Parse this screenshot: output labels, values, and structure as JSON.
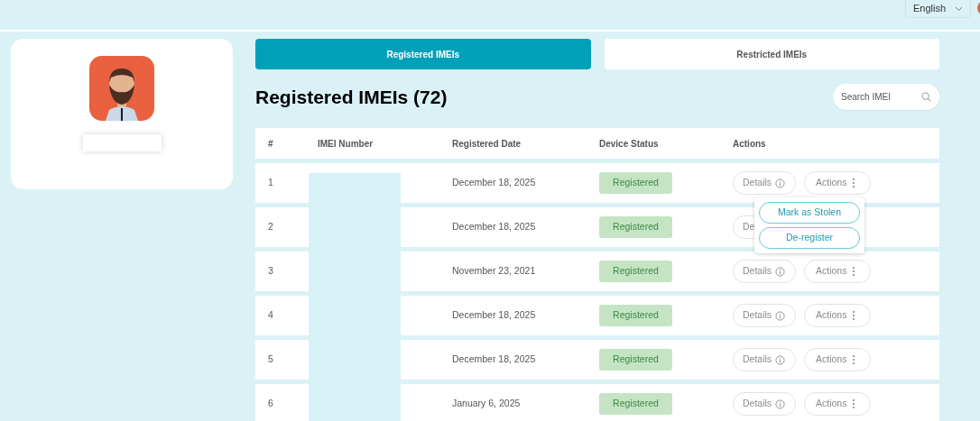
{
  "language_select": {
    "value": "English"
  },
  "tabs": [
    {
      "label": "Registered IMEIs",
      "selected": true
    },
    {
      "label": "Restricted IMEIs",
      "selected": false
    }
  ],
  "title": "Registered IMEIs (72)",
  "search": {
    "placeholder": "Search IMEI"
  },
  "table": {
    "columns": [
      "#",
      "IMEI Number",
      "Registered Date",
      "Device Status",
      "Actions"
    ],
    "rows": [
      {
        "index": "1",
        "date": "December 18, 2025",
        "status": "Registered",
        "buttons": [
          {
            "kind": "details",
            "label": "Details"
          },
          {
            "kind": "actions",
            "label": "Actions"
          }
        ],
        "menu": [
          "Mark as Stolen",
          "De-register"
        ]
      },
      {
        "index": "2",
        "date": "December 18, 2025",
        "status": "Registered",
        "buttons": [
          {
            "kind": "covered",
            "label": "De"
          }
        ]
      },
      {
        "index": "3",
        "date": "November 23, 2021",
        "status": "Registered",
        "buttons": [
          {
            "kind": "details",
            "label": "Details"
          },
          {
            "kind": "actions",
            "label": "Actions"
          }
        ]
      },
      {
        "index": "4",
        "date": "December 18, 2025",
        "status": "Registered",
        "buttons": [
          {
            "kind": "details",
            "label": "Details"
          },
          {
            "kind": "actions",
            "label": "Actions"
          }
        ]
      },
      {
        "index": "5",
        "date": "December 18, 2025",
        "status": "Registered",
        "buttons": [
          {
            "kind": "details",
            "label": "Details"
          },
          {
            "kind": "actions",
            "label": "Actions"
          }
        ]
      },
      {
        "index": "6",
        "date": "January 6, 2025",
        "status": "Registered",
        "buttons": [
          {
            "kind": "details",
            "label": "Details"
          },
          {
            "kind": "actions",
            "label": "Actions"
          }
        ]
      }
    ]
  }
}
